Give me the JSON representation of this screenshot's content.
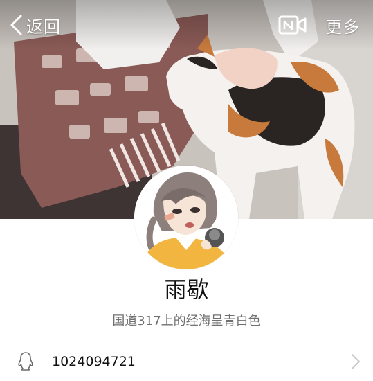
{
  "header": {
    "back_label": "返回",
    "more_label": "更多",
    "video_icon": "video-call-icon",
    "back_icon": "chevron-left-icon"
  },
  "profile": {
    "nickname": "雨歇",
    "signature": "国道317上的经海呈青白色",
    "qq_number": "1024094721",
    "qq_icon": "qq-penguin-icon",
    "row_icon": "chevron-right-icon"
  },
  "colors": {
    "header_text": "#ffffff",
    "name_text": "#111111",
    "signature_text": "#707070",
    "chevron": "#c8c8c8"
  }
}
